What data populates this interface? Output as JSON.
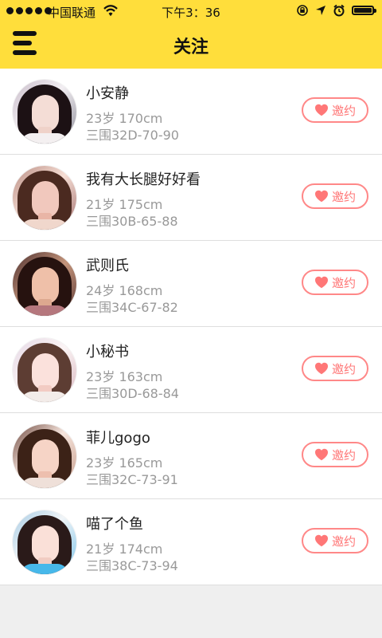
{
  "status_bar": {
    "carrier": "中国联通",
    "time": "下午3：36",
    "icons": [
      "signal-dots-icon",
      "wifi-icon",
      "rotation-lock-icon",
      "location-arrow-icon",
      "alarm-icon",
      "battery-icon"
    ]
  },
  "nav": {
    "menu_icon": "menu-icon",
    "title": "关注"
  },
  "colors": {
    "header": "#ffde3b",
    "accent": "#ff7777",
    "text": "#222222",
    "secondary": "#999999"
  },
  "profiles": [
    {
      "name": "小安静",
      "age_height": "23岁 170cm",
      "measurements": "三围32D-70-90",
      "invite_label": "邀约"
    },
    {
      "name": "我有大长腿好好看",
      "age_height": "21岁 175cm",
      "measurements": "三围30B-65-88",
      "invite_label": "邀约"
    },
    {
      "name": "武则氏",
      "age_height": "24岁 168cm",
      "measurements": "三围34C-67-82",
      "invite_label": "邀约"
    },
    {
      "name": "小秘书",
      "age_height": "23岁 163cm",
      "measurements": "三围30D-68-84",
      "invite_label": "邀约"
    },
    {
      "name": "菲儿gogo",
      "age_height": "23岁 165cm",
      "measurements": "三围32C-73-91",
      "invite_label": "邀约"
    },
    {
      "name": "喵了个鱼",
      "age_height": "21岁 174cm",
      "measurements": "三围38C-73-94",
      "invite_label": "邀约"
    }
  ]
}
